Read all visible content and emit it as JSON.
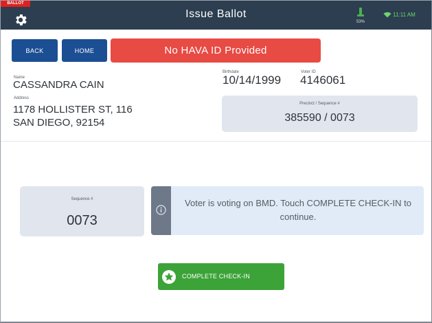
{
  "header": {
    "badge": "BALLOT",
    "title": "Issue Ballot",
    "signal_label": "53%",
    "time": "11:11 AM",
    "icons": {
      "settings": "gear-icon",
      "signal": "signal-icon",
      "wifi": "wifi-icon"
    }
  },
  "toolbar": {
    "back_label": "BACK",
    "home_label": "HOME",
    "alert_text": "No HAVA ID Provided"
  },
  "voter": {
    "name_label": "Name",
    "name": "CASSANDRA CAIN",
    "address_label": "Address",
    "address_line1": "1178 HOLLISTER ST, 116",
    "address_line2": "SAN DIEGO, 92154",
    "birthdate_label": "Birthdate",
    "birthdate": "10/14/1999",
    "voter_id_label": "Voter ID",
    "voter_id": "4146061",
    "precinct_label": "Precinct / Sequence #",
    "precinct_value": "385590 / 0073"
  },
  "sequence": {
    "label": "Sequence #",
    "value": "0073"
  },
  "info": {
    "icon": "info-icon",
    "message": "Voter is voting on BMD. Touch COMPLETE CHECK-IN to continue."
  },
  "complete": {
    "label": "COMPLETE CHECK-IN",
    "icon": "star-icon"
  },
  "colors": {
    "header_bg": "#2c3e50",
    "button_blue": "#1c4e93",
    "alert_red": "#e84a44",
    "success_green": "#3ca338",
    "card_gray": "#e1e5ee",
    "info_blue": "#e0ebf7"
  }
}
